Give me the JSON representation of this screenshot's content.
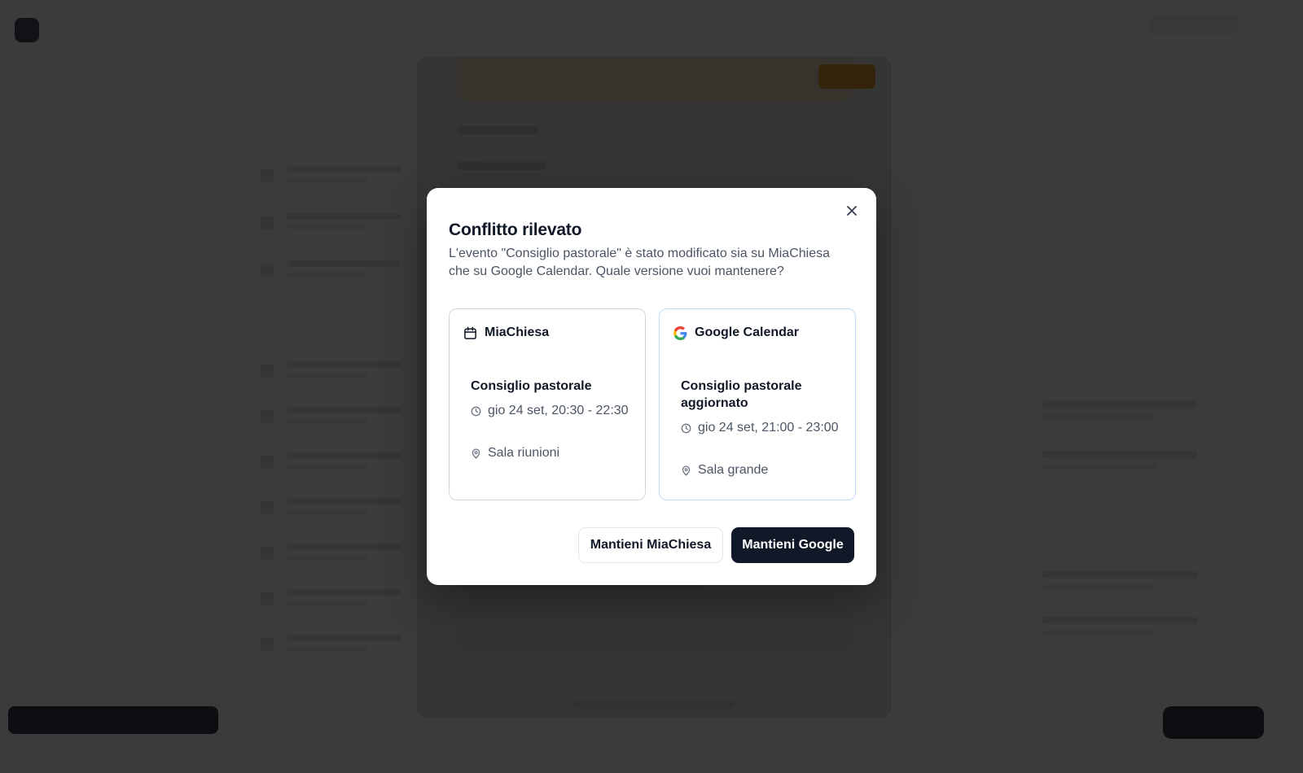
{
  "dialog": {
    "title": "Conflitto rilevato",
    "description": "L'evento \"Consiglio pastorale\" è stato modificato sia su MiaChiesa che su Google Calendar. Quale versione vuoi mantenere?",
    "options": {
      "local": {
        "source_label": "MiaChiesa",
        "icon": "calendar-icon",
        "event_title": "Consiglio pastorale",
        "datetime": "gio 24 set, 20:30 - 22:30",
        "location": "Sala riunioni"
      },
      "google": {
        "source_label": "Google Calendar",
        "icon": "google-icon",
        "event_title": "Consiglio pastorale aggiornato",
        "datetime": "gio 24 set, 21:00 - 23:00",
        "location": "Sala grande"
      }
    },
    "buttons": {
      "keep_local": "Mantieni MiaChiesa",
      "keep_google": "Mantieni Google"
    }
  },
  "colors": {
    "primary": "#111827",
    "google_border": "#bfdbfe",
    "overlay": "#0c0c0e"
  }
}
